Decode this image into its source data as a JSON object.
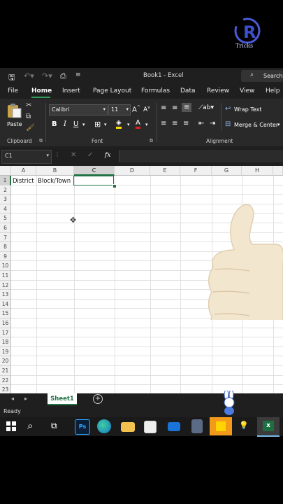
{
  "titlebar": {
    "title": "Book1  -  Excel",
    "search_label": "Search"
  },
  "tabs": [
    "File",
    "Home",
    "Insert",
    "Page Layout",
    "Formulas",
    "Data",
    "Review",
    "View",
    "Help"
  ],
  "ribbon": {
    "paste_label": "Paste",
    "font_name": "Calibri",
    "font_size": "11",
    "wrap_text_label": "Wrap Text",
    "merge_center_label": "Merge & Center",
    "groups": {
      "clipboard": "Clipboard",
      "font": "Font",
      "alignment": "Alignment"
    }
  },
  "formula_bar": {
    "name_box": "C1",
    "fx_label": "fx"
  },
  "grid": {
    "columns": [
      "A",
      "B",
      "C",
      "D",
      "E",
      "F",
      "G",
      "H"
    ],
    "selected_column": "C",
    "rows": [
      "1",
      "2",
      "3",
      "4",
      "5",
      "6",
      "7",
      "8",
      "9",
      "10",
      "11",
      "12",
      "13",
      "14",
      "15",
      "16",
      "17",
      "18",
      "19",
      "20",
      "21",
      "22",
      "23"
    ],
    "cells": {
      "A1": "District",
      "B1": "Block/Town"
    },
    "selected_cell": "C1"
  },
  "sheets": {
    "active": "Sheet1"
  },
  "status": {
    "text": "Ready"
  },
  "watermark": {
    "logo_text": "Tricks"
  },
  "colors": {
    "excel_green": "#217346",
    "dark_bg": "#1f1f1f"
  }
}
